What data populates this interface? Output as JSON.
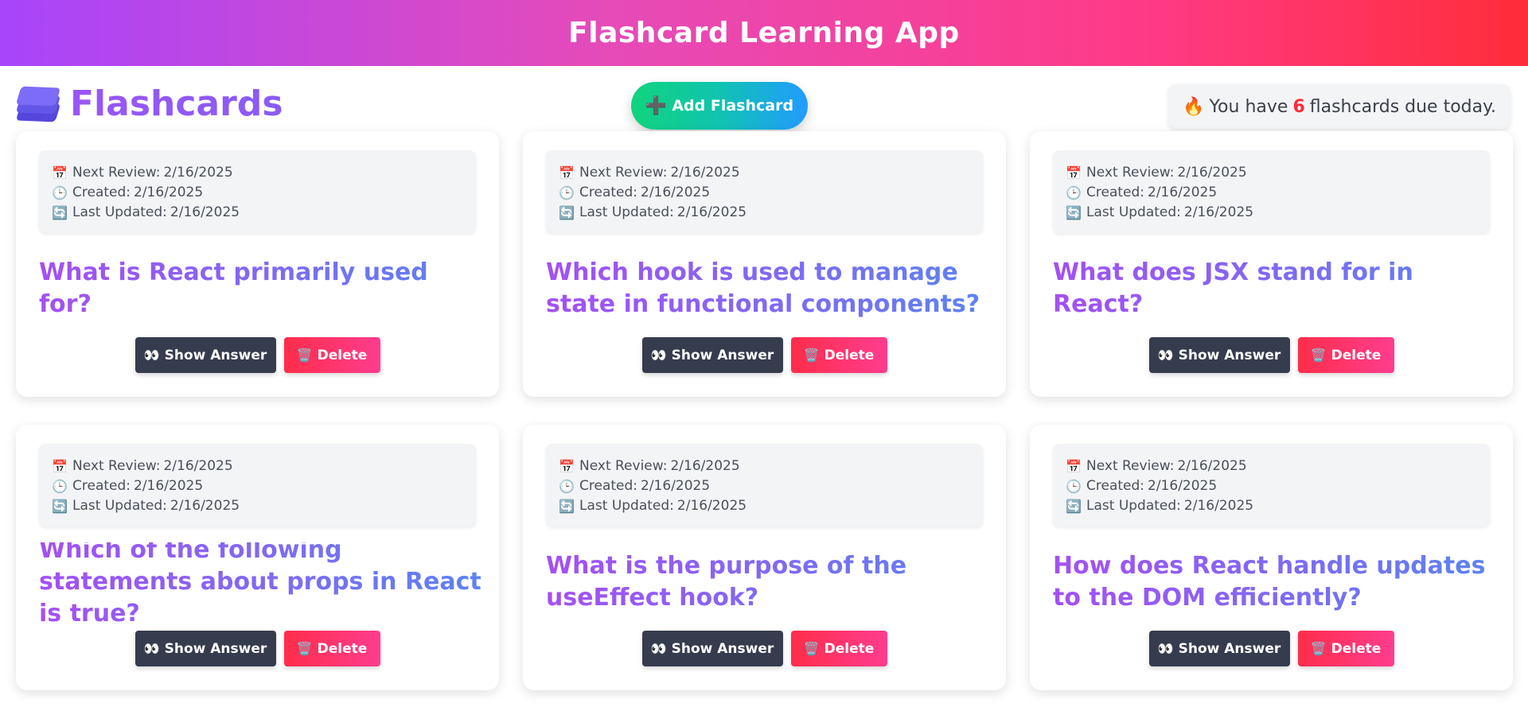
{
  "header": {
    "title": "Flashcard Learning App"
  },
  "toolbar": {
    "brand_icon": "stacked-layers-icon",
    "brand_title": "Flashcards",
    "add_icon": "plus-icon",
    "add_label": "Add Flashcard",
    "due_icon": "fire-icon",
    "due_prefix": "You have",
    "due_count": "6",
    "due_suffix": "flashcards due today."
  },
  "labels": {
    "next_review": "Next Review:",
    "created": "Created:",
    "last_updated": "Last Updated:",
    "show_answer": "Show Answer",
    "delete": "Delete"
  },
  "icons": {
    "calendar": "📅",
    "clock": "🕒",
    "refresh": "🔄",
    "eyes": "👀",
    "trash": "🗑️",
    "fire": "🔥",
    "plus": "➕"
  },
  "colors": {
    "header_gradient": [
      "#a745fb",
      "#ff2d3a"
    ],
    "add_gradient": [
      "#10d47c",
      "#229bff"
    ],
    "show_button": "#363c4e",
    "delete_gradient": [
      "#ff2d4a",
      "#ff3d8f"
    ],
    "question_gradient": [
      "#a54ff4",
      "#5b83f2"
    ],
    "due_count": "#ff2b3a"
  },
  "cards": [
    {
      "next_review": "2/16/2025",
      "created": "2/16/2025",
      "last_updated": "2/16/2025",
      "question": "What is React primarily used for?"
    },
    {
      "next_review": "2/16/2025",
      "created": "2/16/2025",
      "last_updated": "2/16/2025",
      "question": "Which hook is used to manage state in functional components?"
    },
    {
      "next_review": "2/16/2025",
      "created": "2/16/2025",
      "last_updated": "2/16/2025",
      "question": "What does JSX stand for in React?"
    },
    {
      "next_review": "2/16/2025",
      "created": "2/16/2025",
      "last_updated": "2/16/2025",
      "question": "Which of the following statements about props in React is true?"
    },
    {
      "next_review": "2/16/2025",
      "created": "2/16/2025",
      "last_updated": "2/16/2025",
      "question": "What is the purpose of the useEffect hook?"
    },
    {
      "next_review": "2/16/2025",
      "created": "2/16/2025",
      "last_updated": "2/16/2025",
      "question": "How does React handle updates to the DOM efficiently?"
    }
  ]
}
